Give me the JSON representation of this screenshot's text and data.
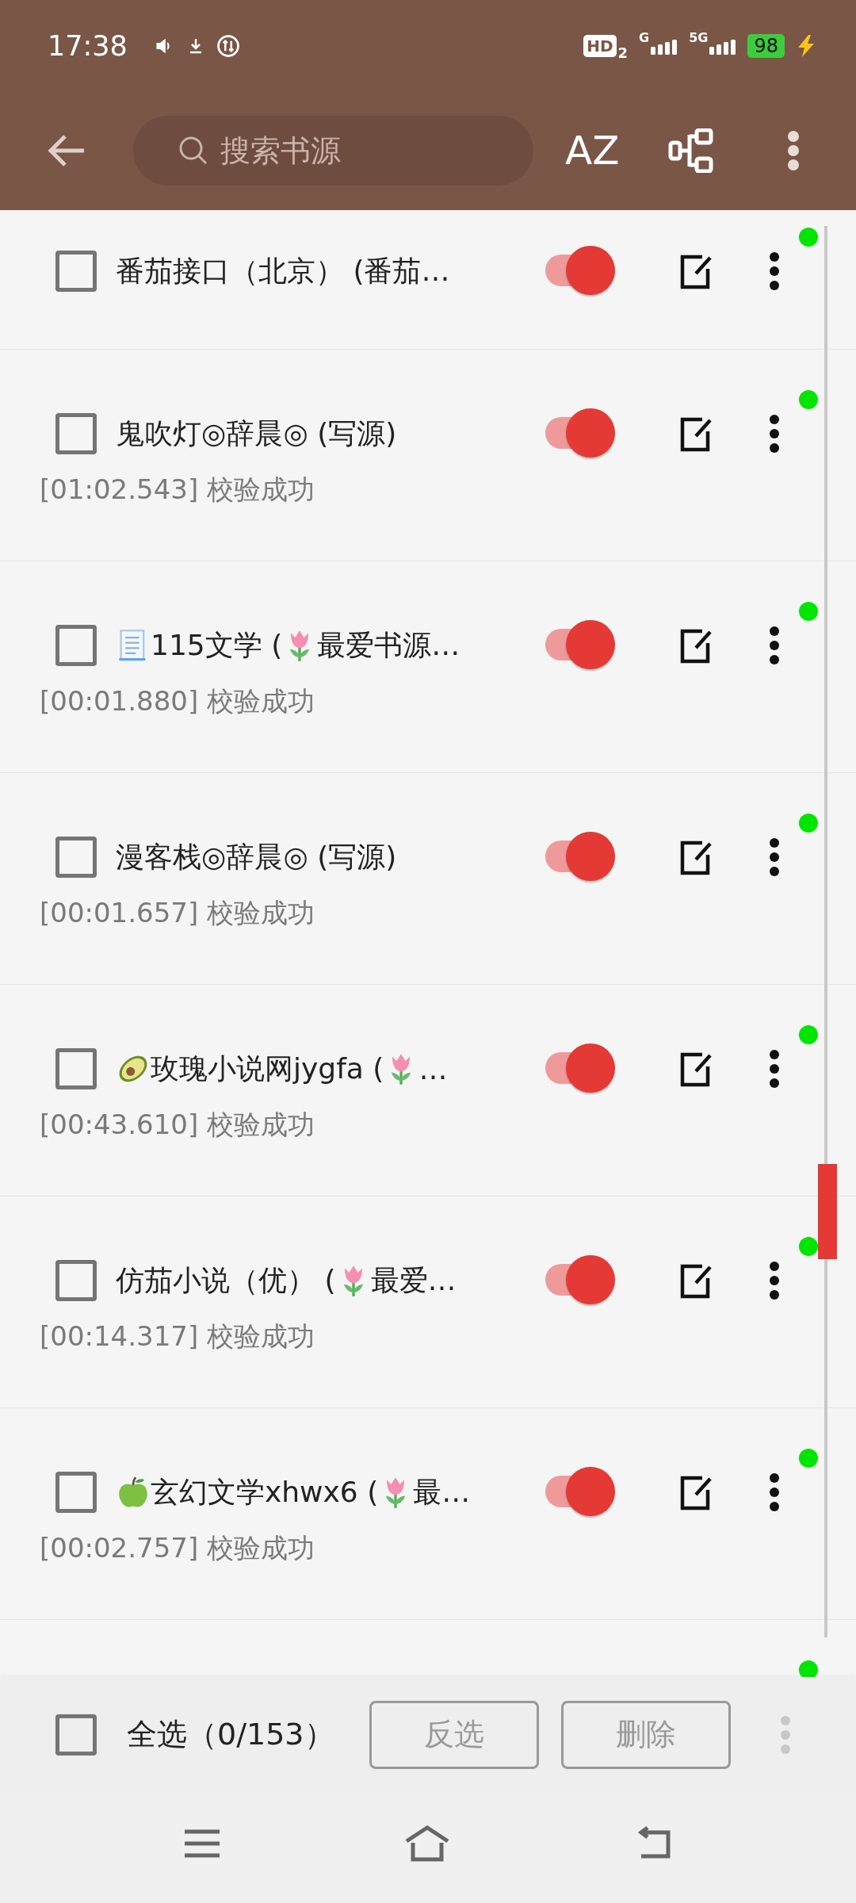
{
  "status_bar": {
    "time": "17:38",
    "hd_label": "HD",
    "hd_sub": "2",
    "network_1": "G",
    "network_2": "5G",
    "battery": "98"
  },
  "toolbar": {
    "search_placeholder": "搜索书源",
    "sort_label": "AZ"
  },
  "rows": [
    {
      "name": [
        {
          "kind": "text",
          "text": "番茄接口（北京） (番茄…"
        }
      ],
      "checked": false,
      "enabled": true,
      "color": "#00e600"
    },
    {
      "name": [
        {
          "kind": "text",
          "text": "鬼吹灯◎辞晨◎ (写源)"
        }
      ],
      "status": "[01:02.543] 校验成功",
      "checked": false,
      "enabled": true,
      "color": "#00e600"
    },
    {
      "name": [
        {
          "kind": "document"
        },
        {
          "kind": "text",
          "text": "115文学 ("
        },
        {
          "kind": "tulip"
        },
        {
          "kind": "text",
          "text": "最爱书源…"
        }
      ],
      "status": "[00:01.880] 校验成功",
      "checked": false,
      "enabled": true,
      "color": "#00e600"
    },
    {
      "name": [
        {
          "kind": "text",
          "text": "漫客栈◎辞晨◎ (写源)"
        }
      ],
      "status": "[00:01.657] 校验成功",
      "checked": false,
      "enabled": true,
      "color": "#00e600"
    },
    {
      "name": [
        {
          "kind": "avocado"
        },
        {
          "kind": "text",
          "text": "玫瑰小说网jygfa ("
        },
        {
          "kind": "tulip"
        },
        {
          "kind": "text",
          "text": "…"
        }
      ],
      "status": "[00:43.610] 校验成功",
      "checked": false,
      "enabled": true,
      "color": "#00e600"
    },
    {
      "name": [
        {
          "kind": "text",
          "text": "仿茄小说（优） ("
        },
        {
          "kind": "tulip"
        },
        {
          "kind": "text",
          "text": "最爱…"
        }
      ],
      "status": "[00:14.317] 校验成功",
      "checked": false,
      "enabled": true,
      "color": "#00e600"
    },
    {
      "name": [
        {
          "kind": "apple"
        },
        {
          "kind": "text",
          "text": "玄幻文学xhwx6 ("
        },
        {
          "kind": "tulip"
        },
        {
          "kind": "text",
          "text": "最…"
        }
      ],
      "status": "[00:02.757] 校验成功",
      "checked": false,
      "enabled": true,
      "color": "#00e600"
    },
    {
      "color": "#00e600"
    }
  ],
  "bottom_bar": {
    "select_all_checked": false,
    "select_all_label": "全选（0/153）",
    "invert_button": "反选",
    "delete_button": "删除"
  }
}
